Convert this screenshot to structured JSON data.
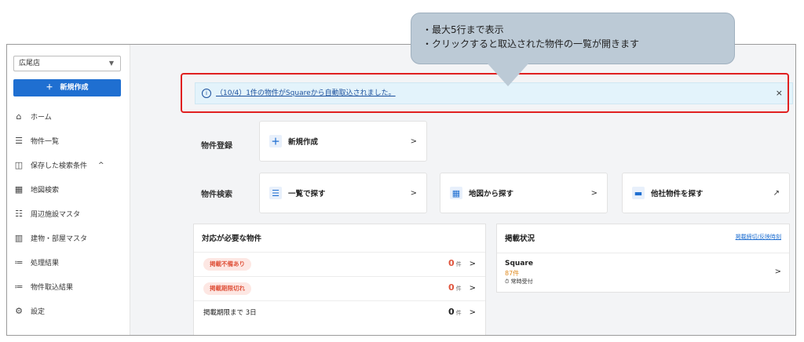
{
  "sidebar": {
    "store_select": "広尾店",
    "new_button": "＋　新規作成",
    "items": [
      {
        "icon": "home-icon",
        "glyph": "⌂",
        "label": "ホーム"
      },
      {
        "icon": "list-icon",
        "glyph": "☰",
        "label": "物件一覧"
      },
      {
        "icon": "saved-search-icon",
        "glyph": "◫",
        "label": "保存した検索条件",
        "caret": "^"
      },
      {
        "icon": "map-search-icon",
        "glyph": "▦",
        "label": "地図検索"
      },
      {
        "icon": "facility-icon",
        "glyph": "☷",
        "label": "周辺施設マスタ"
      },
      {
        "icon": "building-icon",
        "glyph": "▥",
        "label": "建物・部屋マスタ"
      },
      {
        "icon": "process-result-icon",
        "glyph": "≔",
        "label": "処理結果"
      },
      {
        "icon": "import-result-icon",
        "glyph": "≔",
        "label": "物件取込結果"
      },
      {
        "icon": "gear-icon",
        "glyph": "⚙",
        "label": "設定"
      }
    ]
  },
  "banner": {
    "text": "（10/4）1件の物件がSquareから自動取込されました。",
    "close": "×"
  },
  "tooltip": {
    "line1": "・最大5行まで表示",
    "line2": "・クリックすると取込された物件の一覧が開きます"
  },
  "register": {
    "label": "物件登録",
    "new_card": "新規作成",
    "arrow": ">"
  },
  "search": {
    "label": "物件検索",
    "list_card": "一覧で探す",
    "map_card": "地図から探す",
    "other_card": "他社物件を探す",
    "arrow": ">"
  },
  "todo": {
    "title": "対応が必要な物件",
    "rows": [
      {
        "label": "掲載不備あり",
        "count": "0",
        "unit": "件",
        "arrow": ">"
      },
      {
        "label": "掲載期限切れ",
        "count": "0",
        "unit": "件",
        "arrow": ">"
      },
      {
        "label": "掲載期限まで 3日",
        "count": "0",
        "unit": "件",
        "arrow": ">"
      }
    ]
  },
  "listing": {
    "title": "掲載状況",
    "link": "掲載締切/反映時刻",
    "site": "Square",
    "count": "87件",
    "status": "⏱ 常時受付",
    "arrow": ">"
  },
  "colors": {
    "accent": "#1f6fd1",
    "alert_red": "#e02020",
    "tag_red": "#e0553e",
    "banner_bg": "#e3f3fb",
    "tooltip_bg": "#bccad6"
  }
}
